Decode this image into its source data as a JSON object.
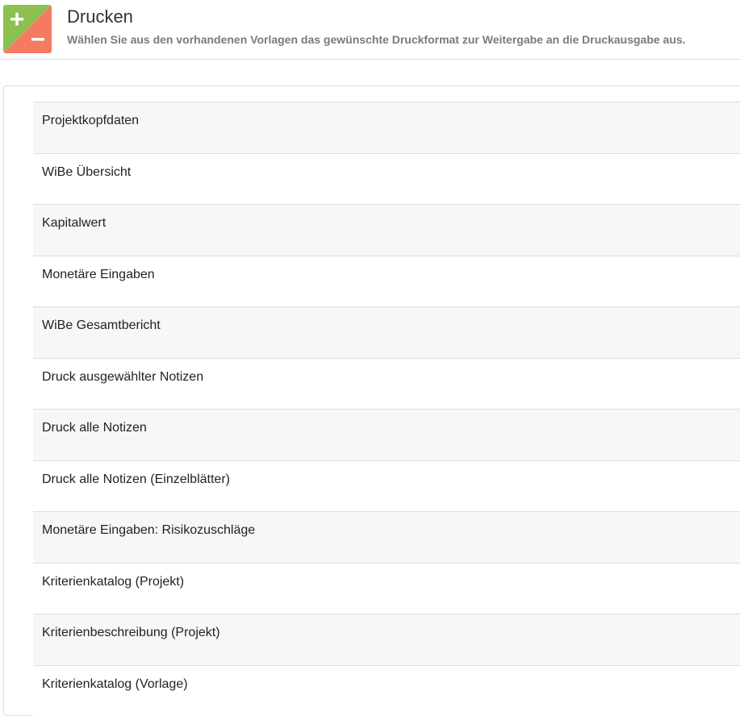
{
  "header": {
    "title": "Drucken",
    "subtitle": "Wählen Sie aus den vorhandenen Vorlagen das gewünschte Druckformat zur Weitergabe an die Druckausgabe aus.",
    "icon": "plus-minus-icon",
    "icon_colors": {
      "top": "#8bc34a",
      "bottom": "#f47a60"
    }
  },
  "print_templates": [
    "Projektkopfdaten",
    "WiBe Übersicht",
    "Kapitalwert",
    "Monetäre Eingaben",
    "WiBe Gesamtbericht",
    "Druck ausgewählter Notizen",
    "Druck alle Notizen",
    "Druck alle Notizen (Einzelblätter)",
    "Monetäre Eingaben: Risikozuschläge",
    "Kriterienkatalog (Projekt)",
    "Kriterienbeschreibung (Projekt)",
    "Kriterienkatalog (Vorlage)"
  ]
}
